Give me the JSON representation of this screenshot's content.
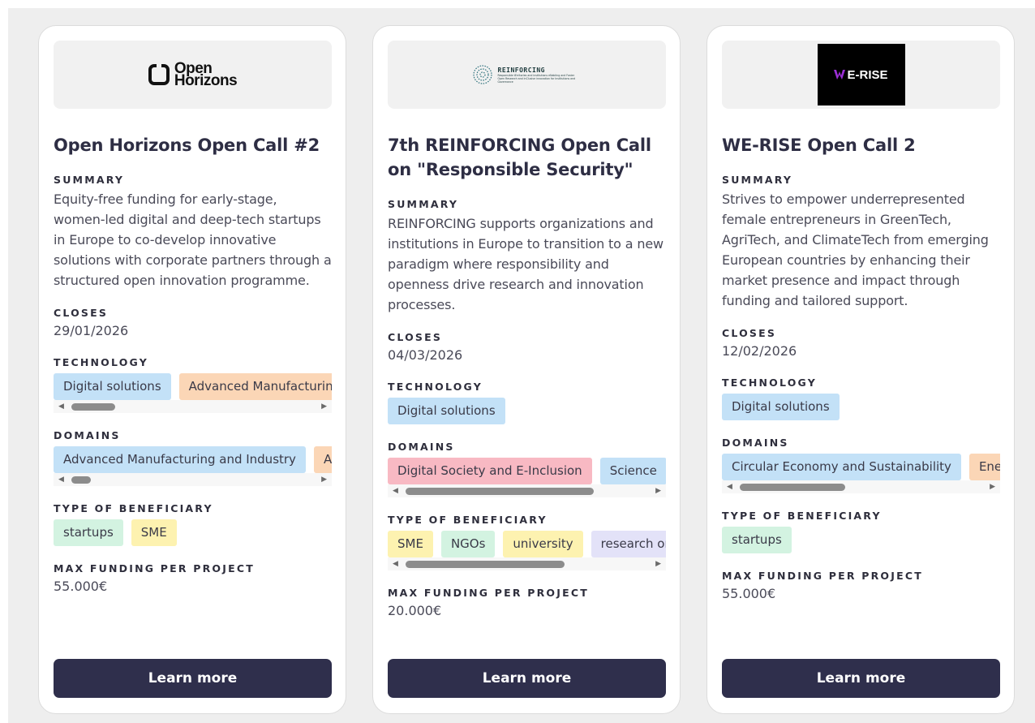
{
  "cards": [
    {
      "logo_text": "Open Horizons",
      "logo_line1": "Open",
      "logo_line2": "Horizons",
      "title": "Open Horizons Open Call #2",
      "summary_label": "SUMMARY",
      "summary": "Equity-free funding for early-stage, women-led digital and deep-tech startups in Europe to co-develop innovative solutions with corporate partners through a structured open innovation programme.",
      "closes_label": "CLOSES",
      "closes": "29/01/2026",
      "technology_label": "TECHNOLOGY",
      "technology": [
        "Digital solutions",
        "Advanced Manufacturing and Industry"
      ],
      "domains_label": "DOMAINS",
      "domains": [
        "Advanced Manufacturing and Industry",
        "Advanced Materials"
      ],
      "beneficiary_label": "TYPE OF BENEFICIARY",
      "beneficiary": [
        "startups",
        "SME"
      ],
      "funding_label": "MAX FUNDING PER PROJECT",
      "funding": "55.000€",
      "button": "Learn more"
    },
    {
      "logo_text": "REINFORCING",
      "logo_subtext": "Responsible tErritories and institutions eNabling and Foster Open Research and inClusive innovation for Institutions and Governance",
      "title": "7th REINFORCING Open Call on \"Responsible Security\"",
      "summary_label": "SUMMARY",
      "summary": "REINFORCING supports organizations and institutions in Europe to transition to a new paradigm where responsibility and openness drive research and innovation processes.",
      "closes_label": "CLOSES",
      "closes": "04/03/2026",
      "technology_label": "TECHNOLOGY",
      "technology": [
        "Digital solutions"
      ],
      "domains_label": "DOMAINS",
      "domains": [
        "Digital Society and E-Inclusion",
        "Science"
      ],
      "beneficiary_label": "TYPE OF BENEFICIARY",
      "beneficiary": [
        "SME",
        "NGOs",
        "university",
        "research organisations"
      ],
      "funding_label": "MAX FUNDING PER PROJECT",
      "funding": "20.000€",
      "button": "Learn more"
    },
    {
      "logo_text": "E-RISE",
      "title": "WE-RISE Open Call 2",
      "summary_label": "SUMMARY",
      "summary": "Strives to empower underrepresented female entrepreneurs in GreenTech, AgriTech, and ClimateTech from emerging European countries by enhancing their market presence and impact through funding and tailored support.",
      "closes_label": "CLOSES",
      "closes": "12/02/2026",
      "technology_label": "TECHNOLOGY",
      "technology": [
        "Digital solutions"
      ],
      "domains_label": "DOMAINS",
      "domains": [
        "Circular Economy and Sustainability",
        "Energy"
      ],
      "beneficiary_label": "TYPE OF BENEFICIARY",
      "beneficiary": [
        "startups"
      ],
      "funding_label": "MAX FUNDING PER PROJECT",
      "funding": "55.000€",
      "button": "Learn more"
    }
  ],
  "colors": {
    "tag_blue": "#c3e1f7",
    "tag_orange": "#fbd6b6",
    "tag_green": "#d3f3e1",
    "tag_yellow": "#fdf2b0",
    "tag_pink": "#f8b9c3",
    "tag_lavender": "#e3e2f8",
    "button_bg": "#2f2f4c"
  }
}
